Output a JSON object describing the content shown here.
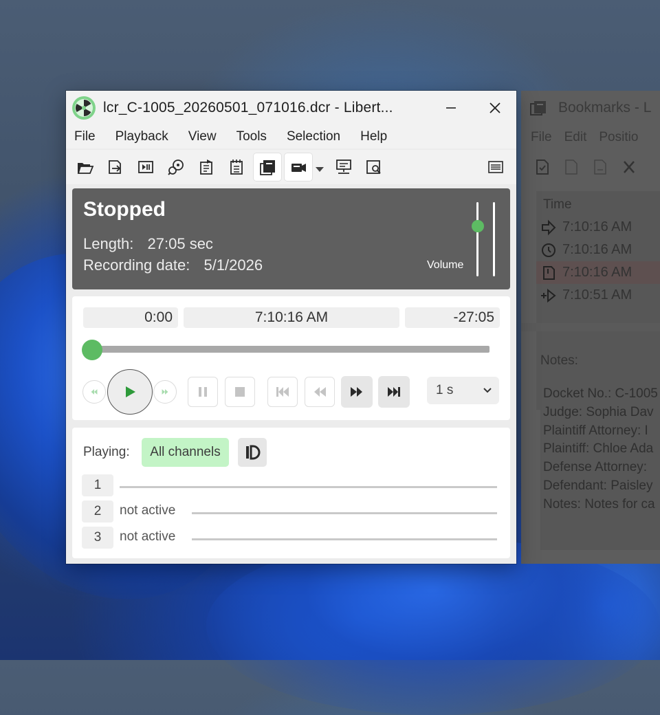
{
  "main_window": {
    "title": "lcr_C-1005_20260501_071016.dcr - Libert...",
    "menu": [
      "File",
      "Playback",
      "View",
      "Tools",
      "Selection",
      "Help"
    ],
    "status": {
      "state": "Stopped",
      "length_label": "Length:",
      "length_value": "27:05 sec",
      "date_label": "Recording date:",
      "date_value": "5/1/2026",
      "volume_label": "Volume",
      "volume_level": 0.68
    },
    "transport": {
      "elapsed": "0:00",
      "clock_time": "7:10:16 AM",
      "remaining": "-27:05",
      "position": 0.0,
      "step_value": "1 s"
    },
    "channels": {
      "playing_label": "Playing:",
      "all_channels_label": "All channels",
      "rows": [
        {
          "number": "1",
          "state": ""
        },
        {
          "number": "2",
          "state": "not active"
        },
        {
          "number": "3",
          "state": "not active"
        }
      ]
    }
  },
  "bookmarks_window": {
    "title": "Bookmarks - L",
    "menu": [
      "File",
      "Edit",
      "Positio"
    ],
    "column_header": "Time",
    "rows": [
      {
        "icon": "go-to-icon",
        "time": "7:10:16 AM",
        "selected": false
      },
      {
        "icon": "clock-icon",
        "time": "7:10:16 AM",
        "selected": false
      },
      {
        "icon": "note-icon",
        "time": "7:10:16 AM",
        "selected": true
      },
      {
        "icon": "insert-icon",
        "time": "7:10:51 AM",
        "selected": false
      }
    ],
    "notes_label": "Notes:",
    "notes": [
      "Docket No.: C-1005",
      "Judge: Sophia Dav",
      "Plaintiff Attorney: I",
      "Plaintiff: Chloe Ada",
      "Defense Attorney: ",
      "Defendant: Paisley",
      "Notes: Notes for ca"
    ]
  },
  "colors": {
    "accent_green": "#5dbb63",
    "all_channels_bg": "#c3f4c6",
    "status_panel_bg": "#5f5f5f"
  }
}
